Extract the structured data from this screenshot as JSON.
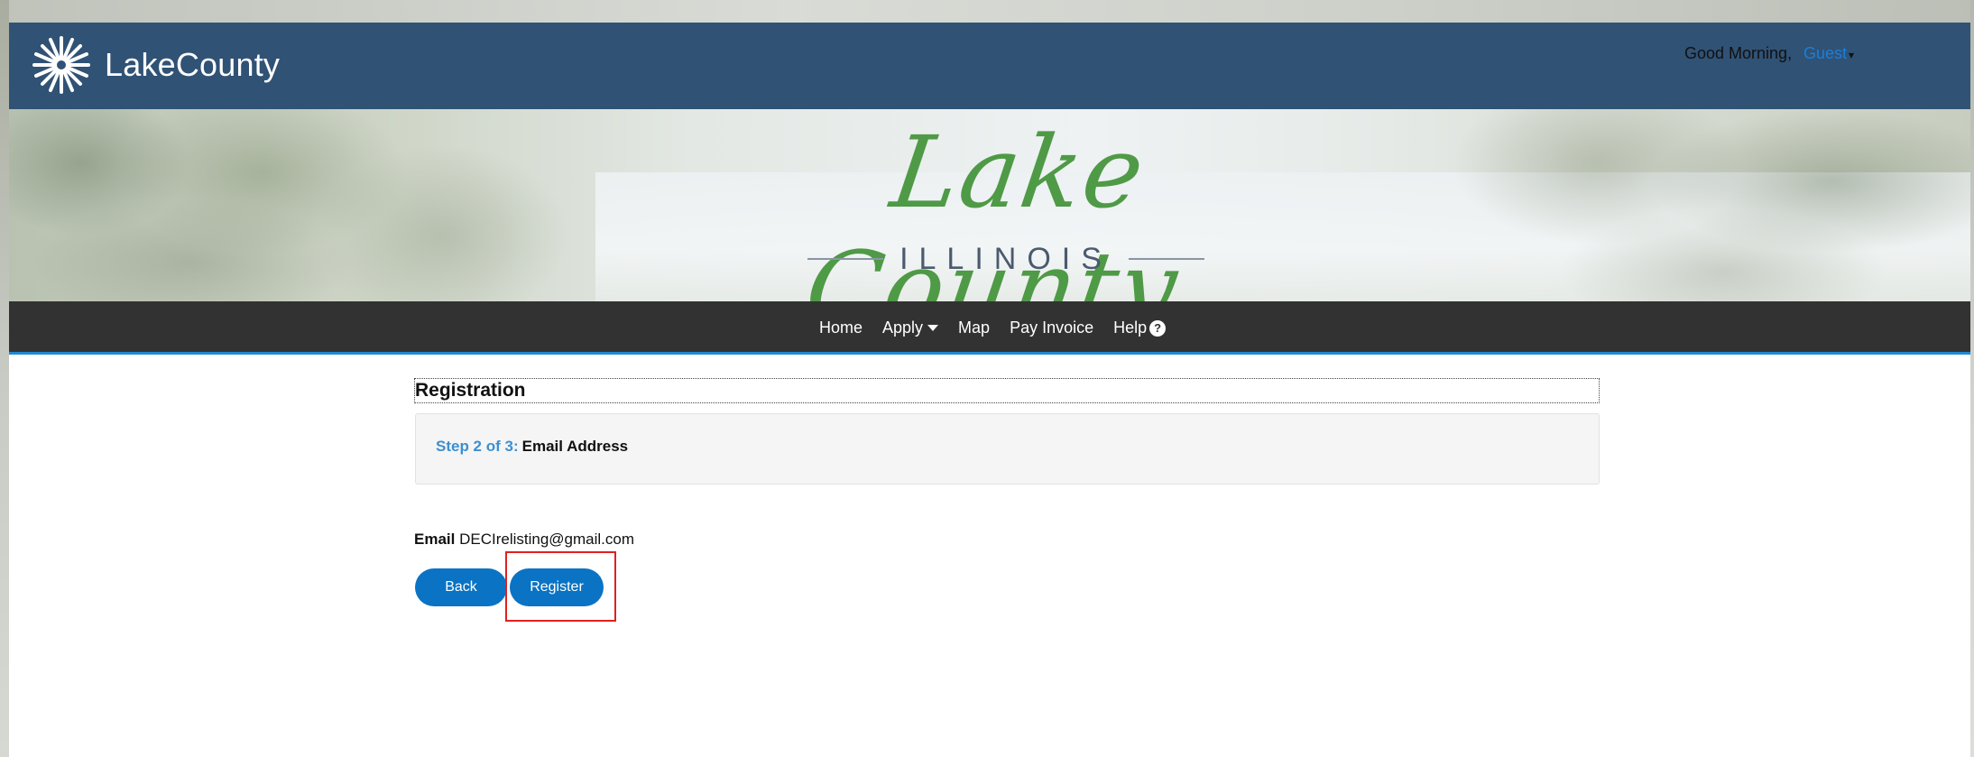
{
  "header": {
    "brand": "LakeCounty",
    "greeting": "Good Morning,",
    "user": "Guest"
  },
  "banner": {
    "script_title": "Lake County,",
    "state": "ILLINOIS"
  },
  "nav": {
    "items": [
      {
        "label": "Home"
      },
      {
        "label": "Apply"
      },
      {
        "label": "Map"
      },
      {
        "label": "Pay Invoice"
      },
      {
        "label": "Help"
      }
    ]
  },
  "main": {
    "title": "Registration",
    "step": {
      "progress": "Step 2 of 3:",
      "name": "Email Address"
    },
    "email_label": "Email",
    "email_value": "DECIrelisting@gmail.com",
    "buttons": {
      "back": "Back",
      "register": "Register"
    }
  },
  "colors": {
    "header_bg": "#305275",
    "nav_bg": "#323232",
    "accent": "#0a73c4",
    "step_blue": "#3d8fd0",
    "script_green": "#4f9a46",
    "highlight": "#e02020"
  }
}
